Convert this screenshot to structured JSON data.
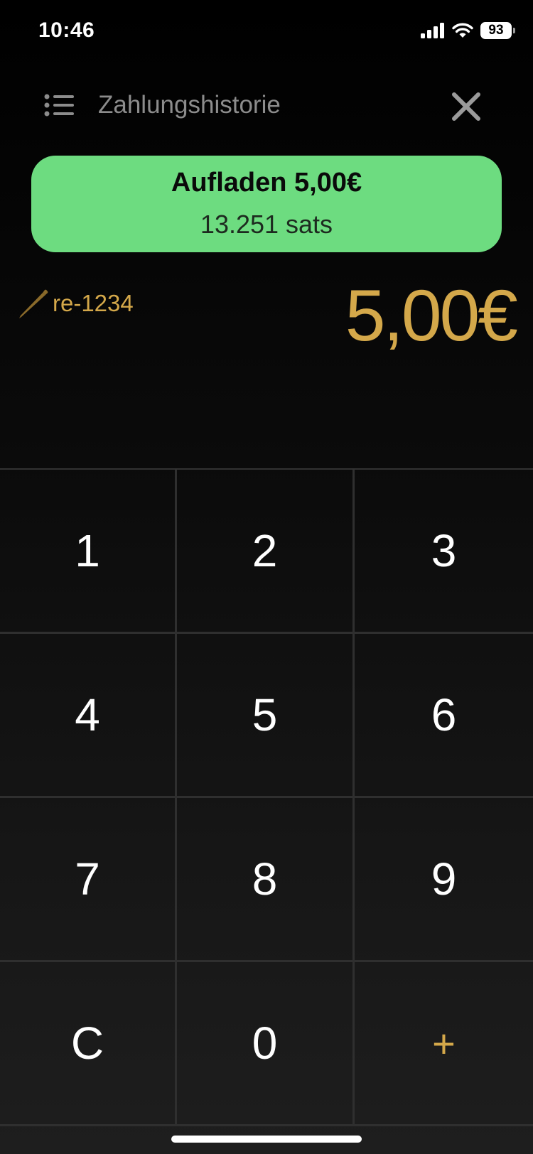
{
  "status_bar": {
    "time": "10:46",
    "battery_level": "93",
    "icons": [
      "cellular-signal-icon",
      "wifi-icon",
      "battery-icon"
    ]
  },
  "header": {
    "history_label": "Zahlungshistorie",
    "history_icon": "list-icon",
    "close_icon": "close-icon"
  },
  "charge": {
    "title": "Aufladen 5,00€",
    "sats": "13.251 sats",
    "color": "#6ddc80"
  },
  "memo": {
    "icon": "pencil-icon",
    "text": "re-1234"
  },
  "amount": {
    "value": "5,00€",
    "color": "#d4a84a"
  },
  "keypad": {
    "keys": [
      "1",
      "2",
      "3",
      "4",
      "5",
      "6",
      "7",
      "8",
      "9",
      "C",
      "0",
      "+"
    ]
  }
}
